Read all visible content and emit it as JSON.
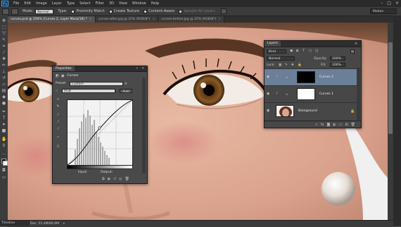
{
  "app": {
    "logo": "Ps"
  },
  "menu": [
    "File",
    "Edit",
    "Image",
    "Layer",
    "Type",
    "Select",
    "Filter",
    "3D",
    "View",
    "Window",
    "Help"
  ],
  "window_controls": [
    "–",
    "□",
    "×"
  ],
  "options_bar": {
    "mode_label": "Mode:",
    "mode_value": "Normal",
    "type_label": "Type:",
    "proximity_match": "Proximity Match",
    "create_texture": "Create Texture",
    "content_aware": "Content-Aware",
    "sample_all_layers": "Sample All Layers",
    "workspace": "Motion"
  },
  "tabs": [
    {
      "label": "curves.psd @ 200% (Curves 2, Layer Mask/16) *",
      "active": true
    },
    {
      "label": "curves-after.jpg @ 25% (RGB/8*)",
      "active": false
    },
    {
      "label": "curves-before.jpg @ 25% (RGB/8*)",
      "active": false
    }
  ],
  "status_bar": {
    "zoom": "200%",
    "doc": "Doc: 55.4M/60.6M"
  },
  "timeline_label": "Timeline",
  "properties": {
    "title": "Properties",
    "panel_name": "Curves",
    "preset_label": "Preset:",
    "preset_value": "Custom",
    "channel_value": "RGB",
    "auto_label": "Auto",
    "input_label": "Input:",
    "output_label": "Output:"
  },
  "layers_panel": {
    "title": "Layers",
    "kind_filter": "Kind",
    "blend_mode": "Normal",
    "opacity_label": "Opacity:",
    "opacity_value": "100%",
    "lock_label": "Lock:",
    "fill_label": "Fill:",
    "fill_value": "100%",
    "layers": [
      {
        "name": "Curves 2",
        "selected": true,
        "mask": "black"
      },
      {
        "name": "Curves 1",
        "selected": false,
        "mask": "white"
      },
      {
        "name": "Background",
        "selected": false,
        "mask": "photo"
      }
    ]
  },
  "colors": {
    "accent": "#31a8ff",
    "panel": "#474747",
    "selected_layer": "#6b7f99"
  }
}
